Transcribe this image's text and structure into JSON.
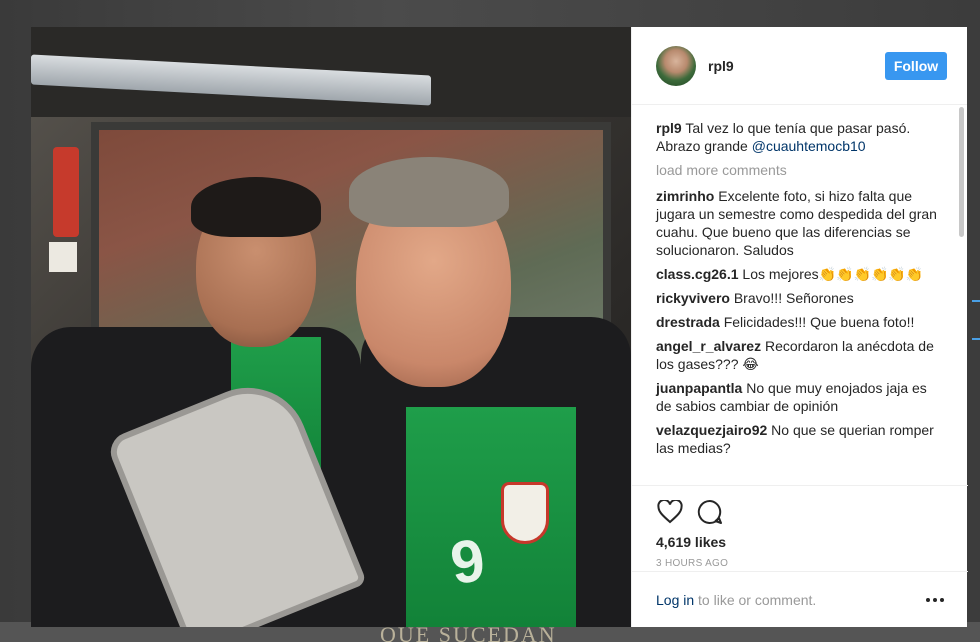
{
  "background": {
    "caption": "QUE SUCEDAN"
  },
  "post": {
    "username": "rpl9",
    "follow_label": "Follow",
    "caption": {
      "username": "rpl9",
      "text": "Tal vez lo que tenía que pasar pasó. Abrazo grande ",
      "mention": "@cuauhtemocb10"
    },
    "load_more": "load more comments",
    "comments": [
      {
        "user": "zimrinho",
        "text": "Excelente foto, si hizo falta que jugara un semestre como despedida del gran cuahu. Que bueno que las diferencias se solucionaron. Saludos"
      },
      {
        "user": "class.cg26.1",
        "text": "Los mejores👏👏👏👏👏👏"
      },
      {
        "user": "rickyvivero",
        "text": "Bravo!!! Señorones"
      },
      {
        "user": "drestrada",
        "text": "Felicidades!!! Que buena foto!!"
      },
      {
        "user": "angel_r_alvarez",
        "text": "Recordaron la anécdota de los gases??? 😂"
      },
      {
        "user": "juanpapantla",
        "text": "No que muy enojados jaja es de sabios cambiar de opinión"
      },
      {
        "user": "velazquezjairo92",
        "text": "No que se querian romper las medias?"
      }
    ],
    "likes": "4,619 likes",
    "time_ago": "3 HOURS AGO",
    "login_link": "Log in",
    "login_text": " to like or comment.",
    "photo": {
      "jersey_number": "9"
    }
  },
  "colors": {
    "follow_button": "#3897f0",
    "mention": "#003569",
    "muted_text": "#999999"
  },
  "icons": {
    "like": "heart-icon",
    "comment": "comment-bubble-icon",
    "more": "more-options-icon"
  }
}
